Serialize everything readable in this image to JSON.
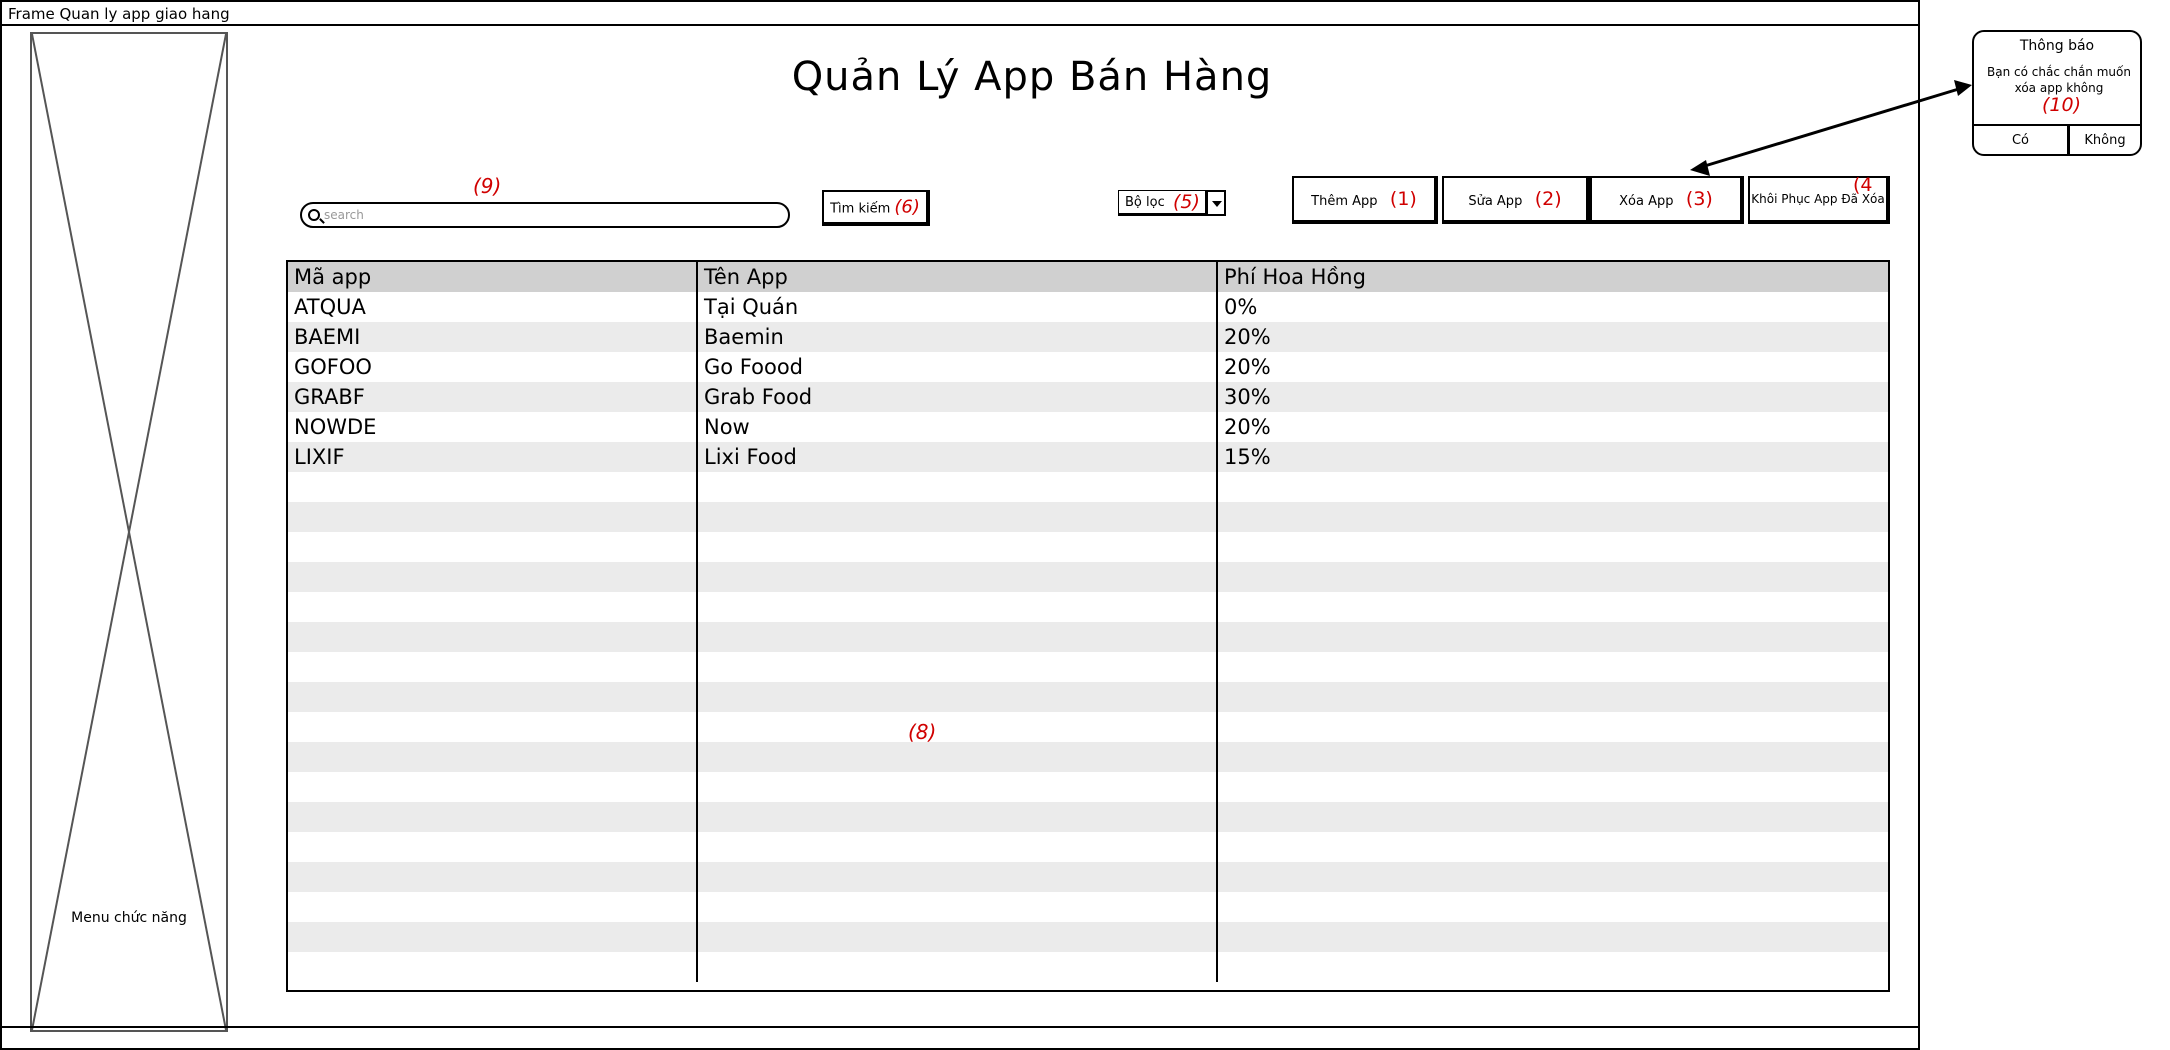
{
  "frame": {
    "title": "Frame Quan ly app giao hang"
  },
  "sidebar": {
    "label": "Menu chức năng"
  },
  "page_title": "Quản Lý App Bán Hàng",
  "search": {
    "placeholder": "search",
    "note": "(9)"
  },
  "search_button": {
    "label": "Tìm kiếm",
    "note": "(6)"
  },
  "filter": {
    "label": "Bộ lọc",
    "note": "(5)"
  },
  "actions": {
    "add": {
      "label": "Thêm App",
      "note": "(1)"
    },
    "edit": {
      "label": "Sửa App",
      "note": "(2)"
    },
    "delete": {
      "label": "Xóa App",
      "note": "(3)"
    },
    "restore": {
      "label": "Khôi Phục App Đã Xóa",
      "note": "(4"
    }
  },
  "table": {
    "columns": [
      "Mã app",
      "Tên App",
      "Phí Hoa Hồng"
    ],
    "rows": [
      [
        "ATQUA",
        "Tại Quán",
        "0%"
      ],
      [
        "BAEMI",
        "Baemin",
        "20%"
      ],
      [
        "GOFOO",
        "Go Foood",
        "20%"
      ],
      [
        "GRABF",
        "Grab Food",
        "30%"
      ],
      [
        "NOWDE",
        "Now",
        "20%"
      ],
      [
        "LIXIF",
        "Lixi Food",
        "15%"
      ]
    ],
    "note": "(8)"
  },
  "dialog": {
    "title": "Thông báo",
    "message": "Bạn có chắc chắn muốn xóa app không",
    "note": "(10)",
    "yes_label": "Có",
    "no_label": "Không"
  }
}
